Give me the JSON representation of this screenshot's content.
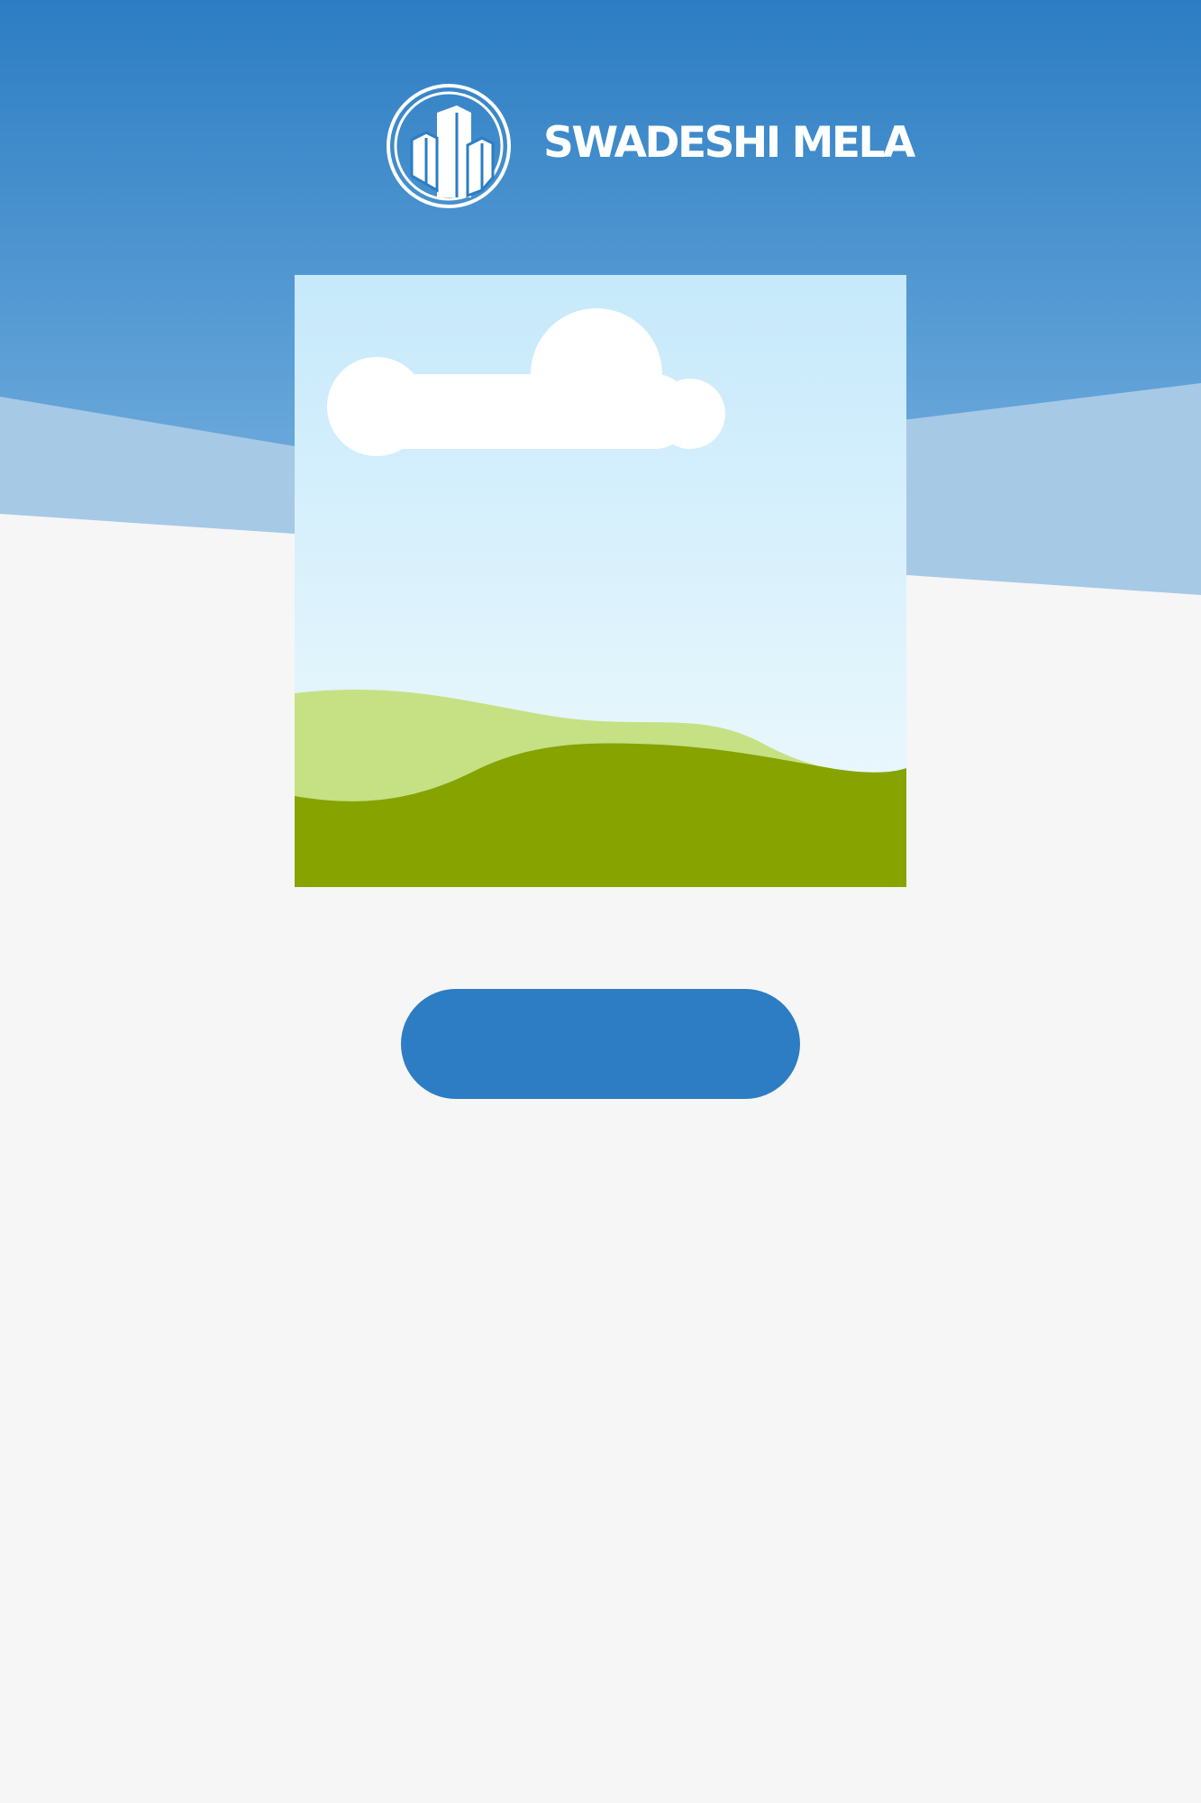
{
  "brand": {
    "name": "SWADESHI MELA",
    "logo_icon": "buildings-in-circle-icon"
  },
  "hero": {
    "image_icon": "landscape-placeholder-icon"
  },
  "action": {
    "button_label": ""
  },
  "colors": {
    "primary_blue": "#2c7dc3",
    "header_blue_light": "#5fa1d6",
    "band_blue_light": "#a6c9e6",
    "page_background": "#f6f6f6",
    "sky_top": "#c6e9fb",
    "sky_bottom": "#f0fafd",
    "hill_light": "#c5e184",
    "hill_dark": "#87a300",
    "cloud": "#ffffff"
  }
}
